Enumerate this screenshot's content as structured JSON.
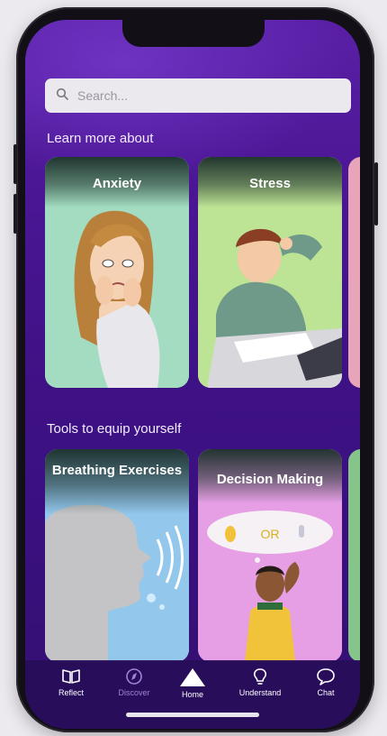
{
  "search": {
    "placeholder": "Search..."
  },
  "sections": {
    "learn_title": "Learn more about",
    "tools_title": "Tools to equip yourself"
  },
  "learn_cards": [
    {
      "title": "Anxiety"
    },
    {
      "title": "Stress"
    }
  ],
  "tool_cards": [
    {
      "title": "Breathing Exercises"
    },
    {
      "title": "Decision Making",
      "thought_text": "OR"
    }
  ],
  "tabbar": {
    "items": [
      {
        "label": "Reflect",
        "icon": "book-icon"
      },
      {
        "label": "Discover",
        "icon": "compass-icon",
        "active": true
      },
      {
        "label": "Home",
        "icon": "triangle-icon"
      },
      {
        "label": "Understand",
        "icon": "lightbulb-icon"
      },
      {
        "label": "Chat",
        "icon": "chat-bubble-icon"
      }
    ]
  },
  "colors": {
    "background_top": "#5a1fa6",
    "background_bottom": "#34106f",
    "active_tab": "#9b86d6"
  }
}
